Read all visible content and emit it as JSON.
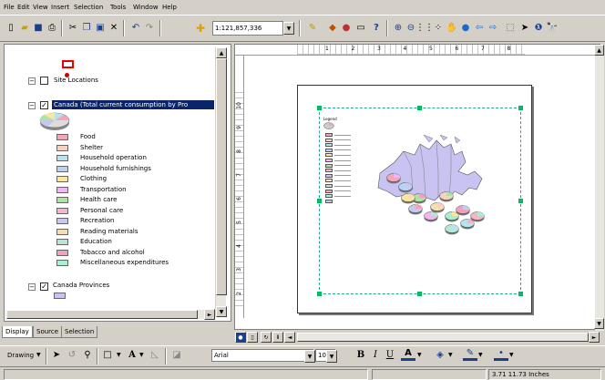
{
  "menu": [
    "File",
    "Edit",
    "View",
    "Insert",
    "Selection",
    "Tools",
    "Window",
    "Help"
  ],
  "toolbar": {
    "scale_value": "1:121,857,336"
  },
  "toc": {
    "layers": [
      {
        "label": "Site Locations",
        "checked": false
      },
      {
        "label": "Canada (Total current consumption  by Pro",
        "checked": true
      },
      {
        "label": "Canada Provinces",
        "checked": true
      }
    ],
    "legend_items": [
      {
        "label": "Food",
        "color": "#f4a6b8"
      },
      {
        "label": "Shelter",
        "color": "#f7d1c0"
      },
      {
        "label": "Household operation",
        "color": "#b6e3f2"
      },
      {
        "label": "Household furnishings",
        "color": "#b9d3f7"
      },
      {
        "label": "Clothing",
        "color": "#f9e79f"
      },
      {
        "label": "Transportation",
        "color": "#f0b6f0"
      },
      {
        "label": "Health care",
        "color": "#a8e6a1"
      },
      {
        "label": "Personal care",
        "color": "#f7b6c8"
      },
      {
        "label": "Recreation",
        "color": "#c7c7f0"
      },
      {
        "label": "Reading materials",
        "color": "#f5deb3"
      },
      {
        "label": "Education",
        "color": "#b5e7d4"
      },
      {
        "label": "Tobacco and alcohol",
        "color": "#f3a0c0"
      },
      {
        "label": "Miscellaneous expenditures",
        "color": "#a8f0d0"
      }
    ],
    "province_fill": "#c8c3f0"
  },
  "tabs": [
    "Display",
    "Source",
    "Selection"
  ],
  "rulers": {
    "top": [
      "1",
      "2",
      "3",
      "4",
      "5",
      "6",
      "7",
      "8"
    ],
    "left": [
      "10",
      "9",
      "8",
      "7",
      "6",
      "5",
      "4",
      "3",
      "2"
    ]
  },
  "map": {
    "legend_title": "Legend"
  },
  "drawbar": {
    "drawing_label": "Drawing",
    "font_name": "Arial",
    "font_size": "10",
    "bold": "B",
    "italic": "I",
    "underline": "U",
    "text_tool": "A"
  },
  "status": {
    "coords": "3.71  11.73 Inches"
  }
}
